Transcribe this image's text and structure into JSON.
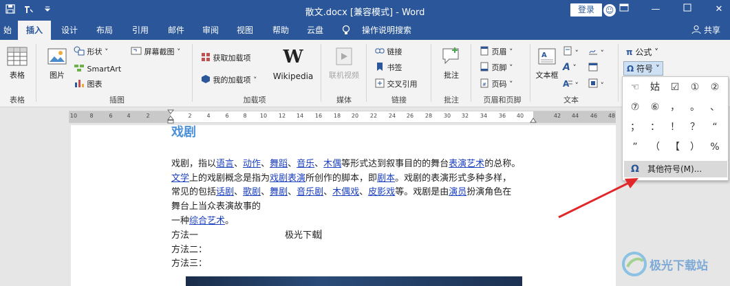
{
  "window": {
    "title": "散文.docx [兼容模式] - Word",
    "login_label": "登录"
  },
  "tabs": [
    {
      "label": "始"
    },
    {
      "label": "插入"
    },
    {
      "label": "设计"
    },
    {
      "label": "布局"
    },
    {
      "label": "引用"
    },
    {
      "label": "邮件"
    },
    {
      "label": "审阅"
    },
    {
      "label": "视图"
    },
    {
      "label": "帮助"
    },
    {
      "label": "云盘"
    },
    {
      "label": "操作说明搜索"
    }
  ],
  "share_label": "共享",
  "ribbon": {
    "groups": {
      "tables": "表格",
      "illustrations": "插图",
      "addins": "加载项",
      "media": "媒体",
      "links": "链接",
      "comments": "批注",
      "header_footer": "页眉和页脚",
      "text": "文本"
    },
    "buttons": {
      "table": "表格",
      "picture": "图片",
      "shapes": "形状",
      "smartart": "SmartArt",
      "chart": "图表",
      "screenshot": "屏幕截图",
      "get_addins": "获取加载项",
      "my_addins": "我的加载项",
      "wikipedia": "Wikipedia",
      "online_video": "联机视频",
      "link": "链接",
      "bookmark": "书签",
      "cross_ref": "交叉引用",
      "comment": "批注",
      "header": "页眉",
      "footer": "页脚",
      "page_number": "页码",
      "textbox": "文本框",
      "equation": "公式",
      "symbol": "符号"
    }
  },
  "symbol_panel": {
    "symbols": [
      "☜",
      "姑",
      "☑",
      "①",
      "②",
      "⑦",
      "⑥",
      "，",
      "。",
      "、",
      "；",
      "：",
      "！",
      "？",
      "“",
      "”",
      "（",
      "【",
      "）",
      "%"
    ],
    "more_label": "其他符号(M)..."
  },
  "ruler": {
    "ticks": [
      "10",
      "8",
      "6",
      "4",
      "2",
      "2",
      "4",
      "6",
      "8",
      "10",
      "12",
      "14",
      "16",
      "18",
      "20",
      "22",
      "24",
      "26",
      "28",
      "30",
      "32",
      "34",
      "36",
      "40",
      "42",
      "44",
      "46",
      "48"
    ]
  },
  "document": {
    "heading": "戏剧",
    "lines": {
      "l1_a": "戏剧，指以",
      "l1_b": "语言",
      "l1_c": "、",
      "l1_d": "动作",
      "l1_e": "、",
      "l1_f": "舞蹈",
      "l1_g": "、",
      "l1_h": "音乐",
      "l1_i": "、",
      "l1_j": "木偶",
      "l1_k": "等形式达到叙事目的的舞台",
      "l1_l": "表演艺术",
      "l1_m": "的总称。",
      "l2_a": "文学",
      "l2_b": "上的戏剧概念是指为",
      "l2_c": "戏剧表演",
      "l2_d": "所创作的脚本，即",
      "l2_e": "剧本",
      "l2_f": "。戏剧的表演形式多种多样，",
      "l3_a": "常见的包括",
      "l3_b": "话剧",
      "l3_c": "、",
      "l3_d": "歌剧",
      "l3_e": "、",
      "l3_f": "舞剧",
      "l3_g": "、",
      "l3_h": "音乐剧",
      "l3_i": "、",
      "l3_j": "木偶戏",
      "l3_k": "、",
      "l3_l": "皮影戏",
      "l3_m": "等。戏剧是由",
      "l3_n": "演员",
      "l3_o": "扮演角色在",
      "l4": "舞台上当众表演故事的",
      "l5_a": "一种",
      "l5_b": "综合艺术",
      "l5_c": "。",
      "l6_a": "方法一",
      "l6_b": "极光下载",
      "l7": "方法二：",
      "l8": "方法三："
    }
  },
  "watermark": "极光下载站"
}
